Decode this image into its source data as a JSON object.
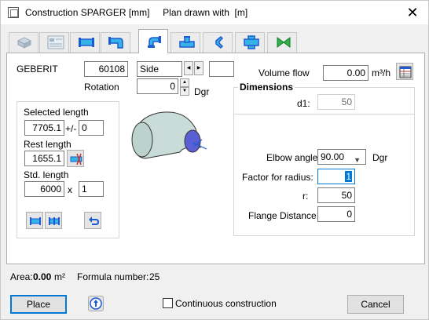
{
  "window": {
    "title": "Construction SPARGER [mm]     Plan drawn with  [m]",
    "close_glyph": "✕"
  },
  "tabs": [
    {
      "icon": "hidden-cube-icon",
      "active": false
    },
    {
      "icon": "form-list-icon",
      "active": false
    },
    {
      "icon": "straight-pipe-icon",
      "active": false
    },
    {
      "icon": "pipe-bend-icon",
      "active": false
    },
    {
      "icon": "elbow-icon",
      "active": true
    },
    {
      "icon": "tee-icon",
      "active": false
    },
    {
      "icon": "reducer-icon",
      "active": false
    },
    {
      "icon": "cross-icon",
      "active": false
    },
    {
      "icon": "valve-icon",
      "active": false
    }
  ],
  "header": {
    "manufacturer": "GEBERIT",
    "article_number": "60108",
    "side_value": "Side",
    "side_extra": "",
    "rotation_label": "Rotation",
    "rotation_value": "0",
    "rotation_unit": "Dgr",
    "volume_flow_label": "Volume flow",
    "volume_flow_value": "0.00",
    "volume_flow_unit": "m³/h"
  },
  "lengths": {
    "selected_label": "Selected length",
    "selected_value": "7705.1",
    "plus_minus": "+/-",
    "tolerance_value": "0",
    "rest_label": "Rest length",
    "rest_value": "1655.1",
    "std_label": "Std. length",
    "std_value": "6000",
    "times": "x",
    "count_value": "1"
  },
  "dimensions": {
    "title": "Dimensions",
    "d1_label": "d1:",
    "d1_value": "50",
    "elbow_angle_label": "Elbow angle:",
    "elbow_angle_value": "90.00",
    "elbow_angle_unit": "Dgr",
    "factor_label": "Factor for radius:",
    "factor_value": "1",
    "r_label": "r:",
    "r_value": "50",
    "flange_label": "Flange Distance.:",
    "flange_value": "0"
  },
  "status": {
    "area_label": "Area:",
    "area_value": "0.00",
    "area_unit": "m²",
    "formula_label": "Formula number:",
    "formula_value": "25"
  },
  "footer": {
    "place_label": "Place",
    "continuous_label": "Continuous construction",
    "cancel_label": "Cancel"
  },
  "colors": {
    "accent": "#0078d7",
    "icon_blue": "#1e5ad2",
    "icon_cyan": "#35b3e6",
    "elbow_fill": "#c9dcd7"
  }
}
